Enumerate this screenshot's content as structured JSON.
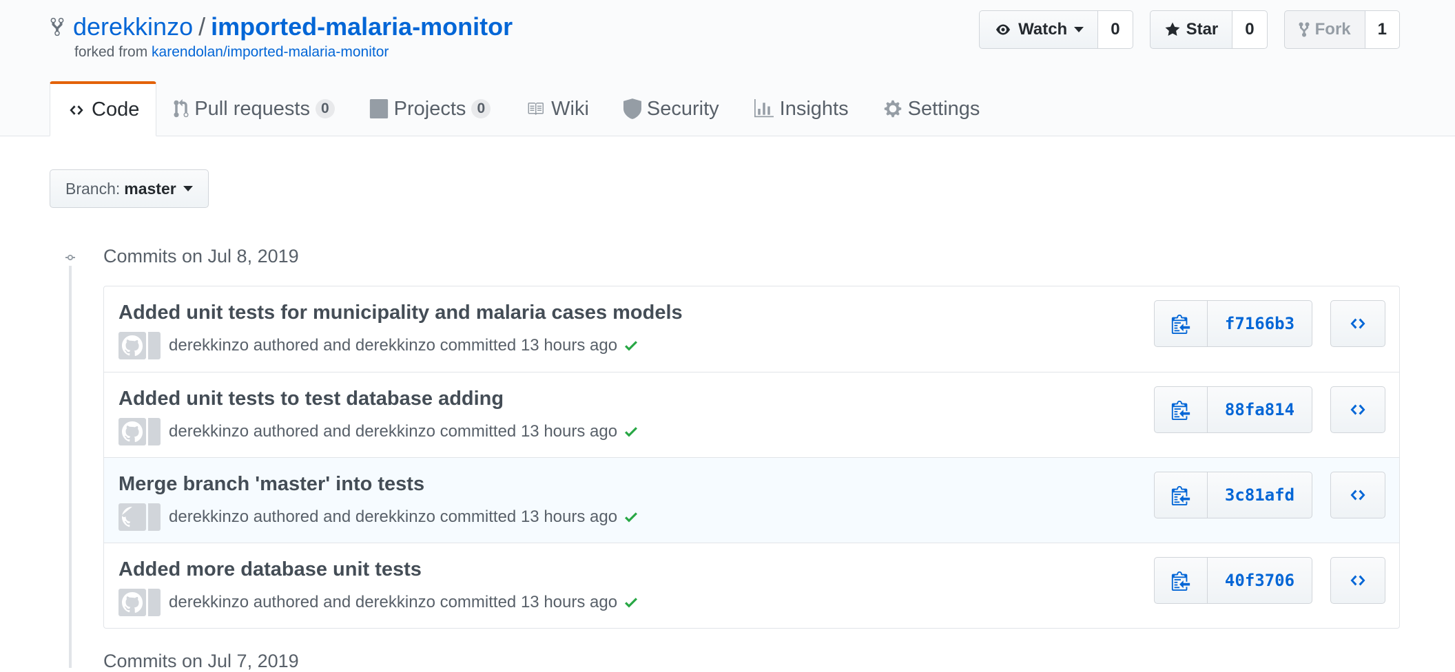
{
  "repo": {
    "owner": "derekkinzo",
    "separator": "/",
    "name": "imported-malaria-monitor",
    "forked_prefix": "forked from",
    "forked_source": "karendolan/imported-malaria-monitor"
  },
  "actions": {
    "watch_label": "Watch",
    "watch_count": "0",
    "star_label": "Star",
    "star_count": "0",
    "fork_label": "Fork",
    "fork_count": "1"
  },
  "tabs": [
    {
      "label": "Code",
      "icon": "code-icon",
      "selected": true
    },
    {
      "label": "Pull requests",
      "badge": "0",
      "icon": "git-pull-request-icon"
    },
    {
      "label": "Projects",
      "badge": "0",
      "icon": "project-icon"
    },
    {
      "label": "Wiki",
      "icon": "book-icon"
    },
    {
      "label": "Security",
      "icon": "shield-icon"
    },
    {
      "label": "Insights",
      "icon": "graph-icon"
    },
    {
      "label": "Settings",
      "icon": "gear-icon"
    }
  ],
  "branch": {
    "prefix": "Branch:",
    "name": "master"
  },
  "commit_groups": [
    {
      "date": "Commits on Jul 8, 2019",
      "commits": [
        {
          "message": "Added unit tests for municipality and malaria cases models",
          "meta": "derekkinzo authored and derekkinzo committed 13 hours ago",
          "sha": "f7166b3",
          "status": "success"
        },
        {
          "message": "Added unit tests to test database adding",
          "meta": "derekkinzo authored and derekkinzo committed 13 hours ago",
          "sha": "88fa814",
          "status": "success"
        },
        {
          "message": "Merge branch 'master' into tests",
          "meta": "derekkinzo authored and derekkinzo committed 13 hours ago",
          "sha": "3c81afd",
          "status": "success"
        },
        {
          "message": "Added more database unit tests",
          "meta": "derekkinzo authored and derekkinzo committed 13 hours ago",
          "sha": "40f3706",
          "status": "success"
        }
      ]
    },
    {
      "date": "Commits on Jul 7, 2019"
    }
  ],
  "colors": {
    "link": "#0366d6",
    "tab_accent": "#e36209",
    "success": "#28a745"
  }
}
